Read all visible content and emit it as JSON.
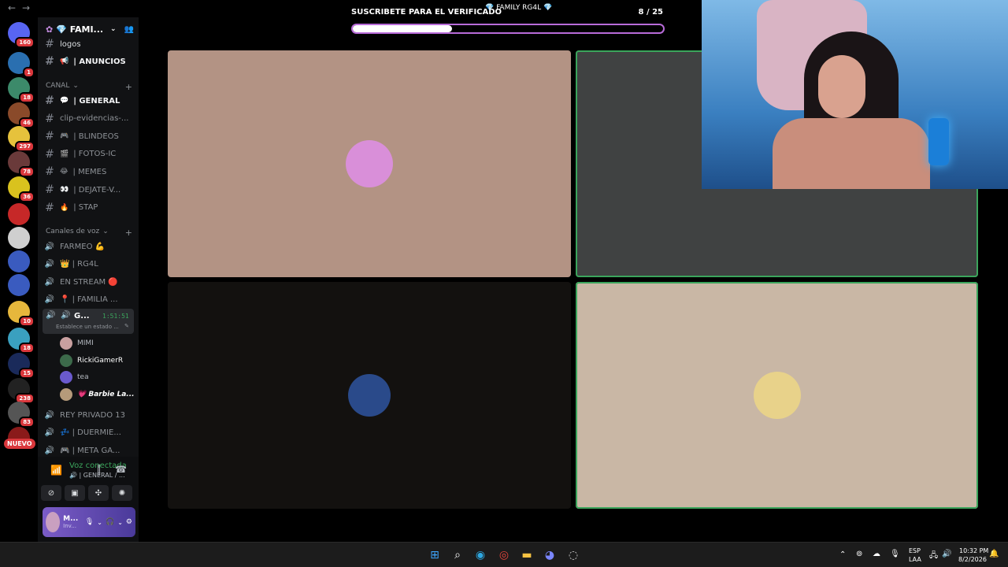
{
  "window": {
    "back_glyph": "←",
    "forward_glyph": "→"
  },
  "rail": {
    "servers": [
      {
        "badge": "160",
        "color": "#5865f2"
      },
      {
        "badge": "1",
        "color": "#2a6fb0"
      },
      {
        "badge": "18",
        "color": "#3c8a6a"
      },
      {
        "badge": "46",
        "color": "#8a4a2a"
      },
      {
        "badge": "297",
        "color": "#e6c23c"
      },
      {
        "badge": "78",
        "color": "#6a3a3a"
      },
      {
        "badge": "36",
        "color": "#d9c21e"
      },
      {
        "badge": "",
        "color": "#c62828"
      },
      {
        "badge": "",
        "color": "#cfcfcf"
      },
      {
        "badge": "",
        "color": "#3a5bbf"
      },
      {
        "badge": "",
        "color": "#3a5bbf"
      },
      {
        "badge": "10",
        "color": "#e6b73c"
      },
      {
        "badge": "18",
        "color": "#3aa0bf"
      },
      {
        "badge": "15",
        "color": "#1a2a5a"
      },
      {
        "badge": "238",
        "color": "#222"
      },
      {
        "badge": "83",
        "color": "#555"
      },
      {
        "badge": "",
        "color": "#8a1a1a"
      }
    ],
    "new_label": "NUEVO"
  },
  "sidebar": {
    "guild_name": "💎 FAMI...",
    "logos_label": "logos",
    "channels_top": [
      {
        "emoji": "📢",
        "name": "| ANUNCIOS",
        "bold": true
      }
    ],
    "category_text": "CANAL",
    "text_channels": [
      {
        "emoji": "💬",
        "name": "| GENERAL",
        "bold": true
      },
      {
        "emoji": "",
        "name": "clip-evidencias-...",
        "bold": false
      },
      {
        "emoji": "🎮",
        "name": "| BLINDEOS",
        "bold": false
      },
      {
        "emoji": "🎬",
        "name": "| FOTOS-IC",
        "bold": false
      },
      {
        "emoji": "😂",
        "name": "| MEMES",
        "bold": false
      },
      {
        "emoji": "👀",
        "name": "| DEJATE-V...",
        "bold": false
      },
      {
        "emoji": "🔥",
        "name": "| STAP",
        "bold": false
      }
    ],
    "category_voice": "Canales de voz",
    "voice_channels": [
      {
        "name": "FARMEO 💪"
      },
      {
        "name": "👑 | RG4L"
      },
      {
        "name": "EN STREAM 🔴"
      },
      {
        "name": "📍 | FAMILIA ..."
      }
    ],
    "active_voice": {
      "name": "G...",
      "timer": "1:51:51",
      "status": "Establece un estado ..."
    },
    "members": [
      {
        "name": "MIMI",
        "color": "#c9a0a0"
      },
      {
        "name": "RickiGamerR",
        "color": "#3c6a4a"
      },
      {
        "name": "tea",
        "color": "#6a5acd"
      },
      {
        "name": "💗 Barbie La...",
        "color": "#b59a7a"
      }
    ],
    "more_voice": [
      {
        "name": "REY PRIVADO 13"
      },
      {
        "name": "💤 | DUERMIE..."
      },
      {
        "name": "🎮 | META GA..."
      }
    ]
  },
  "voice_panel": {
    "status": "Voz conectada",
    "sub": "🔊 | GENERAL / ...",
    "user_name": "M...",
    "user_status": "Inv..."
  },
  "banner": {
    "title": "SUSCRIBETE PARA EL VERIFICADO",
    "overlay": "💎 FAMILY RG4L 💎",
    "count": "8 / 25",
    "progress": 0.32
  },
  "tiles": [
    {
      "bg": "#b39384",
      "avatar": "#d98fd9",
      "speaking": false
    },
    {
      "bg": "#404242",
      "avatar": "",
      "speaking": true
    },
    {
      "bg": "#13110f",
      "avatar": "#2a4a8a",
      "speaking": false
    },
    {
      "bg": "#c9b7a5",
      "avatar": "#e8d28a",
      "speaking": true
    }
  ],
  "taskbar": {
    "lang_top": "ESP",
    "lang_bottom": "LAA",
    "time": "10:32 PM",
    "date": "8/2/2026"
  }
}
